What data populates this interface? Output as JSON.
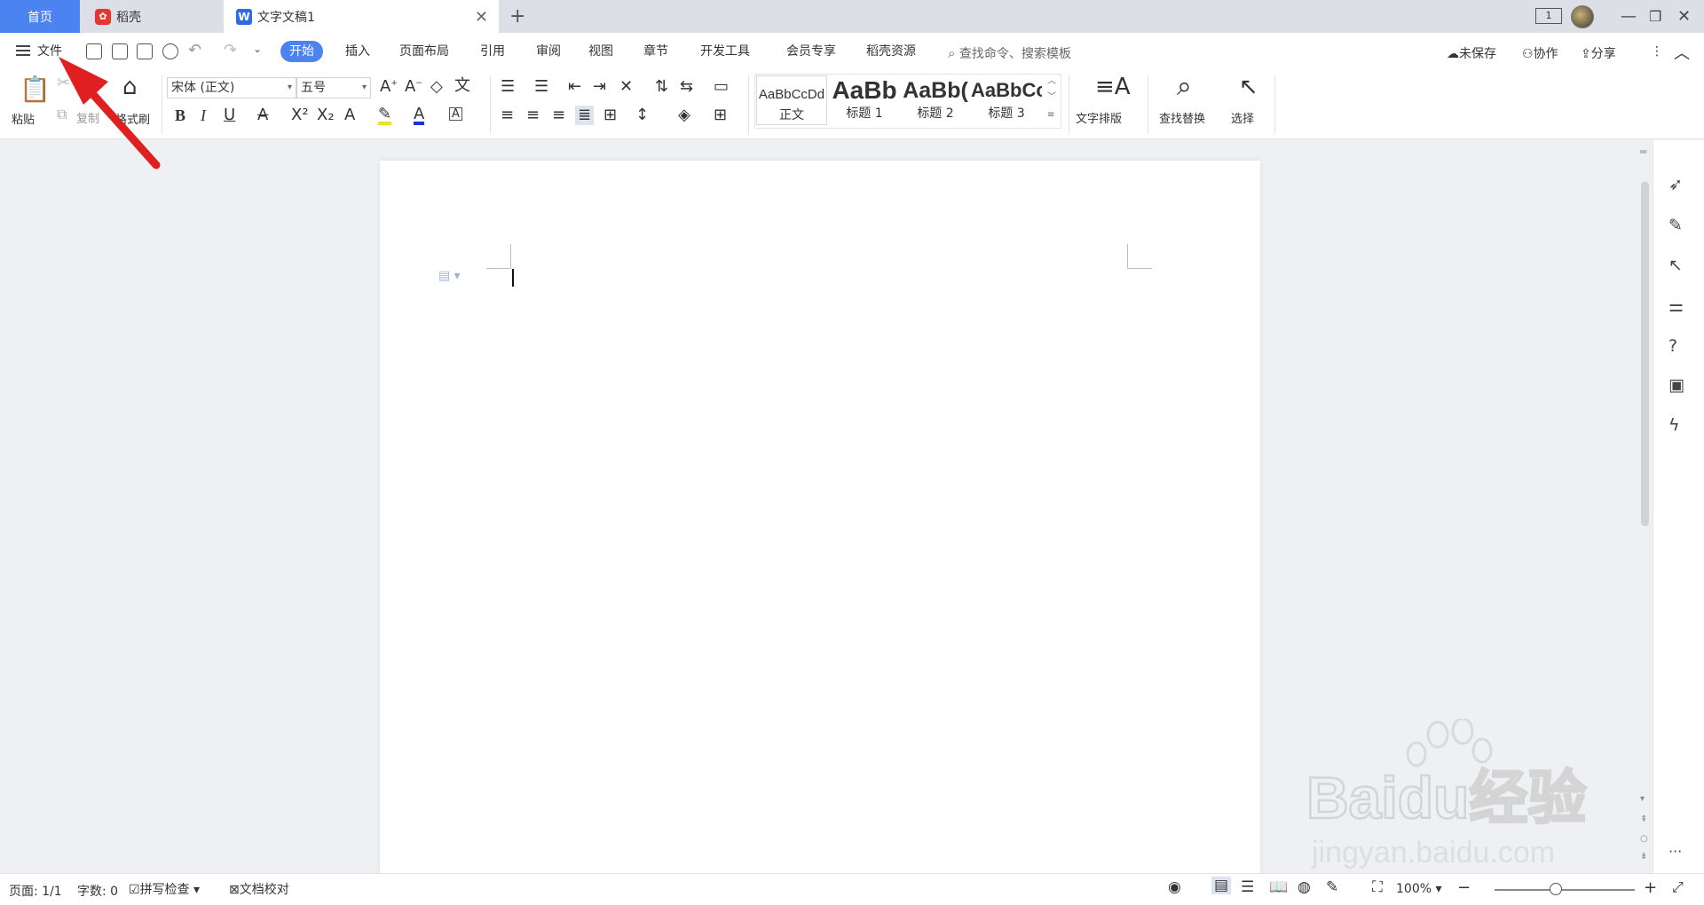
{
  "tabs": {
    "home": "首页",
    "daoke": "稻壳",
    "doc": "文字文稿1",
    "badge": "1"
  },
  "menu": {
    "file": "文件",
    "ribbon_tabs": [
      "开始",
      "插入",
      "页面布局",
      "引用",
      "审阅",
      "视图",
      "章节",
      "开发工具",
      "会员专享",
      "稻壳资源"
    ],
    "search": "查找命令、搜索模板",
    "unsaved": "未保存",
    "collab": "协作",
    "share": "分享"
  },
  "ribbon": {
    "paste": "粘贴",
    "copy": "复制",
    "format_painter": "格式刷",
    "font_name": "宋体 (正文)",
    "font_size": "五号",
    "styles": [
      {
        "preview": "AaBbCcDd",
        "name": "正文"
      },
      {
        "preview": "AaBb",
        "name": "标题 1"
      },
      {
        "preview": "AaBb(",
        "name": "标题 2"
      },
      {
        "preview": "AaBbCc",
        "name": "标题 3"
      }
    ],
    "text_layout": "文字排版",
    "find_replace": "查找替换",
    "select": "选择"
  },
  "status": {
    "page": "页面: 1/1",
    "words": "字数: 0",
    "spell": "拼写检查",
    "proof": "文档校对",
    "zoom": "100%"
  },
  "watermark": {
    "brand": "Baidu经验",
    "url": "jingyan.baidu.com"
  },
  "colors": {
    "accent": "#4b84f0",
    "arrow": "#e02020"
  }
}
